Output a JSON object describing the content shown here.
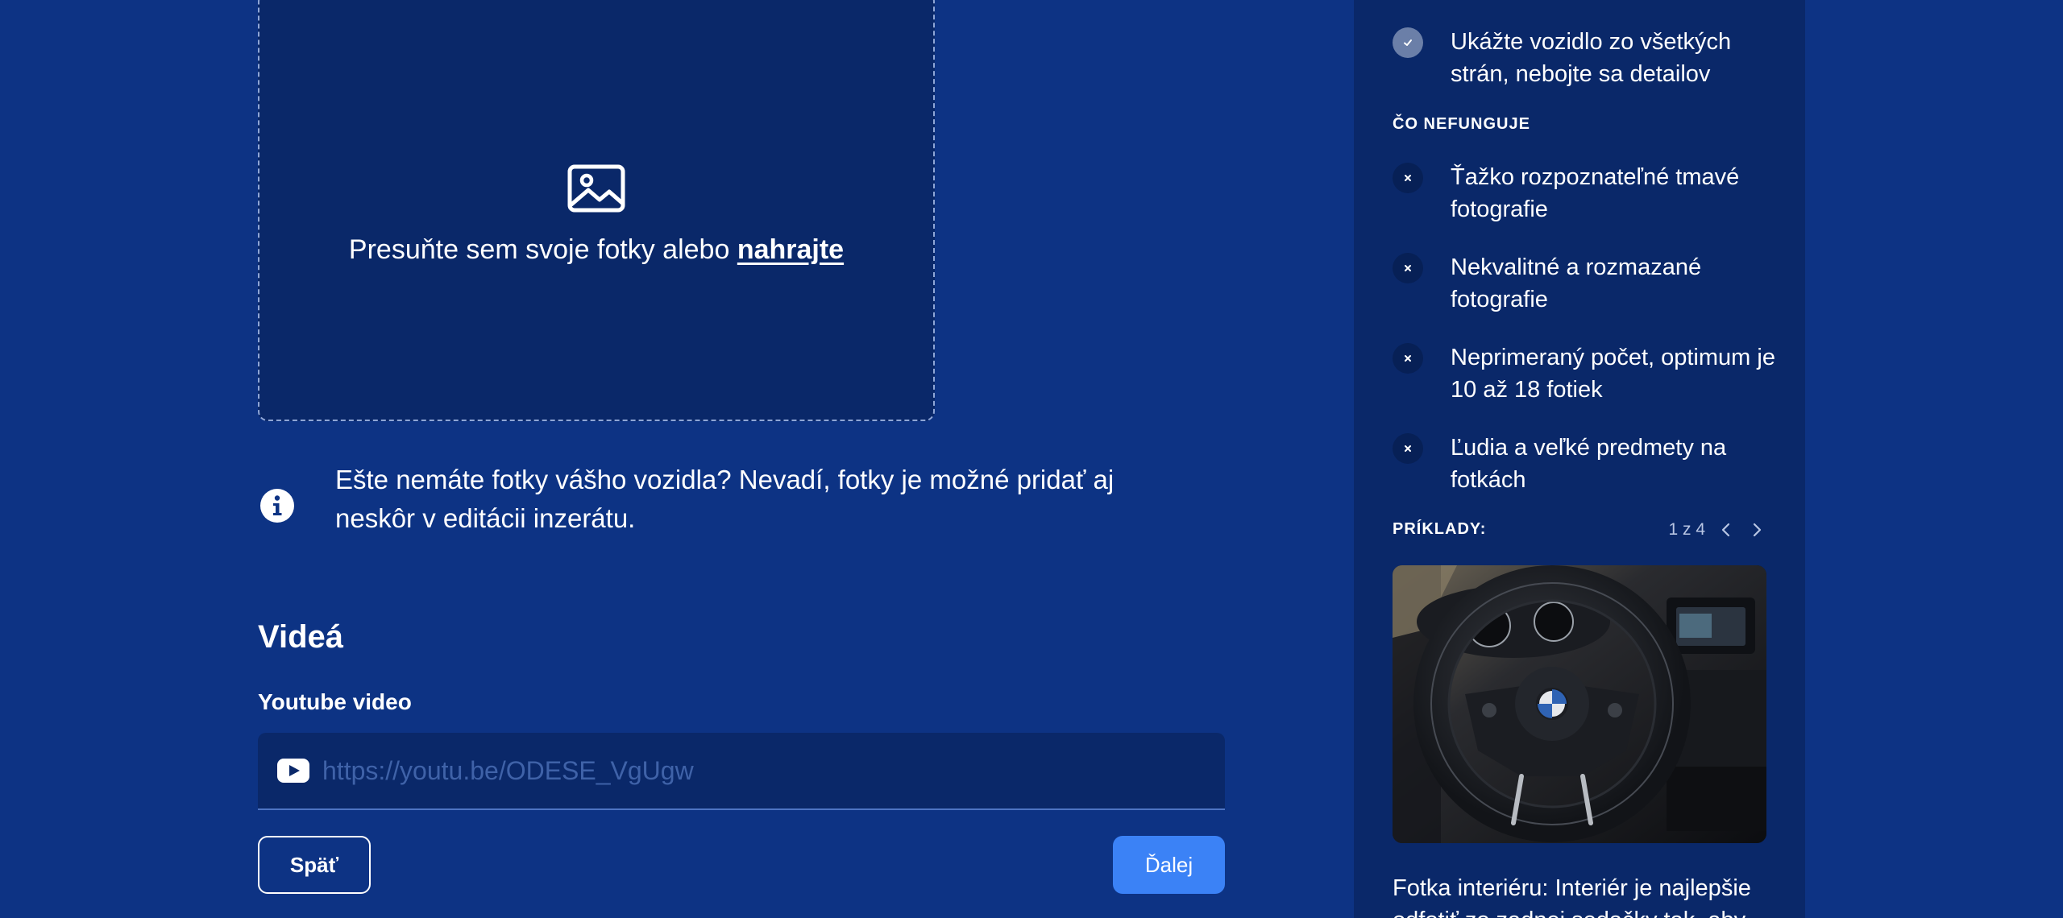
{
  "upload": {
    "drop_text": "Presuňte sem svoje fotky alebo ",
    "upload_link": "nahrajte"
  },
  "info": {
    "text": "Ešte nemáte fotky vášho vozidla? Nevadí, fotky je možné pridať aj neskôr v editácii inzerátu."
  },
  "videos": {
    "heading": "Videá",
    "youtube_label": "Youtube video",
    "youtube_placeholder": "https://youtu.be/ODESE_VgUgw",
    "youtube_value": ""
  },
  "navigation": {
    "back_label": "Späť",
    "next_label": "Ďalej"
  },
  "tips": {
    "works_items": [
      "Ukážte vozidlo zo všetkých strán, nebojte sa detailov"
    ],
    "not_working_heading": "ČO NEFUNGUJE",
    "not_working_items": [
      "Ťažko rozpoznateľné tmavé fotografie",
      "Nekvalitné a rozmazané fotografie",
      "Neprimeraný počet, optimum je 10 až 18 fotiek",
      "Ľudia a veľké predmety na fotkách"
    ],
    "examples_heading": "PRÍKLADY:",
    "examples_pager": "1 z 4",
    "example_caption": "Fotka interiéru: Interiér je najlepšie odfotiť zo zadnej sedačky tak, aby"
  },
  "colors": {
    "page_background": "#0d3384",
    "panel_background": "#0a2869",
    "primary_button": "#3b82f6"
  },
  "icons": {
    "dropzone": "image-icon",
    "info": "info-icon",
    "youtube": "youtube-icon",
    "tip_ok": "check-icon",
    "tip_bad": "close-icon",
    "pager_prev": "chevron-left-icon",
    "pager_next": "chevron-right-icon"
  }
}
